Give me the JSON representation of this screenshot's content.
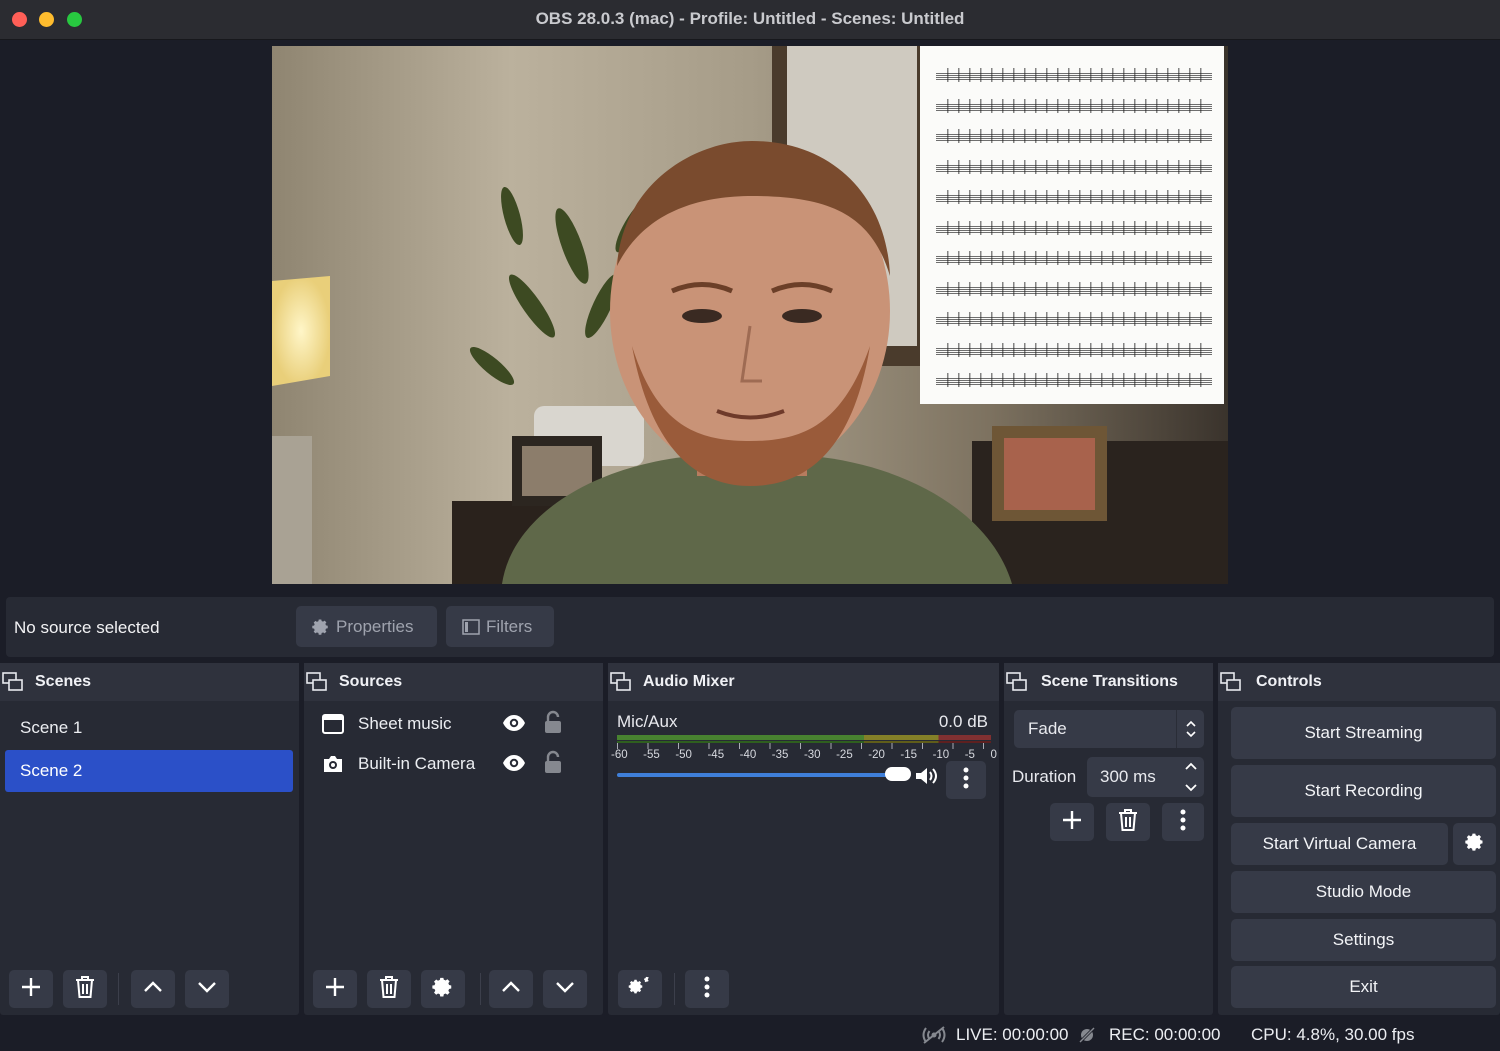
{
  "window": {
    "title": "OBS 28.0.3 (mac) - Profile: Untitled - Scenes: Untitled"
  },
  "source_toolbar": {
    "status": "No source selected",
    "properties_label": "Properties",
    "filters_label": "Filters"
  },
  "scenes": {
    "title": "Scenes",
    "items": [
      {
        "label": "Scene 1"
      },
      {
        "label": "Scene 2"
      }
    ],
    "selected": "Scene 2"
  },
  "sources": {
    "title": "Sources",
    "items": [
      {
        "label": "Sheet music",
        "icon": "window-icon"
      },
      {
        "label": "Built-in Camera",
        "icon": "camera-icon"
      }
    ]
  },
  "audio_mixer": {
    "title": "Audio Mixer",
    "channel": "Mic/Aux",
    "level": "0.0 dB",
    "ticks": [
      "-60",
      "-55",
      "-50",
      "-45",
      "-40",
      "-35",
      "-30",
      "-25",
      "-20",
      "-15",
      "-10",
      "-5",
      "0"
    ],
    "volume_fraction": 1.0
  },
  "transitions": {
    "title": "Scene Transitions",
    "selected": "Fade",
    "duration_label": "Duration",
    "duration_value": "300 ms"
  },
  "controls": {
    "title": "Controls",
    "start_streaming": "Start Streaming",
    "start_recording": "Start Recording",
    "start_virtual_camera": "Start Virtual Camera",
    "studio_mode": "Studio Mode",
    "settings": "Settings",
    "exit": "Exit"
  },
  "status": {
    "live": "LIVE: 00:00:00",
    "rec": "REC: 00:00:00",
    "cpu": "CPU: 4.8%, 30.00 fps"
  },
  "colors": {
    "accent": "#2b50c8",
    "panel": "#272a34",
    "button": "#363a47",
    "background": "#1b1d27"
  }
}
